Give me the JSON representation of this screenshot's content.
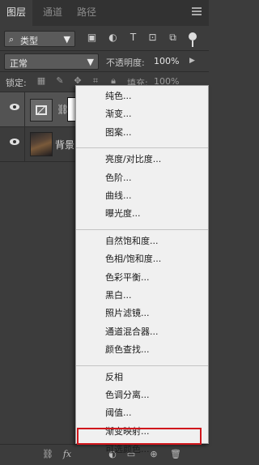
{
  "tabs": [
    "图层",
    "通道",
    "路径"
  ],
  "filter": {
    "kind_label": "类型"
  },
  "blend": {
    "mode": "正常",
    "opacity_label": "不透明度:",
    "opacity_value": "100%"
  },
  "lock": {
    "label": "锁定:",
    "fill_label": "填充:",
    "fill_value": "100%"
  },
  "layers": [
    {
      "name": "",
      "type": "adjustment-with-mask"
    },
    {
      "name": "背景",
      "type": "image"
    }
  ],
  "menu": {
    "groups": [
      [
        "纯色...",
        "渐变...",
        "图案..."
      ],
      [
        "亮度/对比度...",
        "色阶...",
        "曲线...",
        "曝光度..."
      ],
      [
        "自然饱和度...",
        "色相/饱和度...",
        "色彩平衡...",
        "黑白...",
        "照片滤镜...",
        "通道混合器...",
        "颜色查找..."
      ],
      [
        "反相",
        "色调分离...",
        "阈值...",
        "渐变映射...",
        "可选颜色..."
      ]
    ],
    "highlighted_item": "可选颜色..."
  },
  "bottom_bar": {
    "fx_label": "fx"
  },
  "colors": {
    "panel_bg": "#3c3c3c",
    "menu_bg": "#f0f0f0",
    "highlight_border": "#d0161c"
  }
}
